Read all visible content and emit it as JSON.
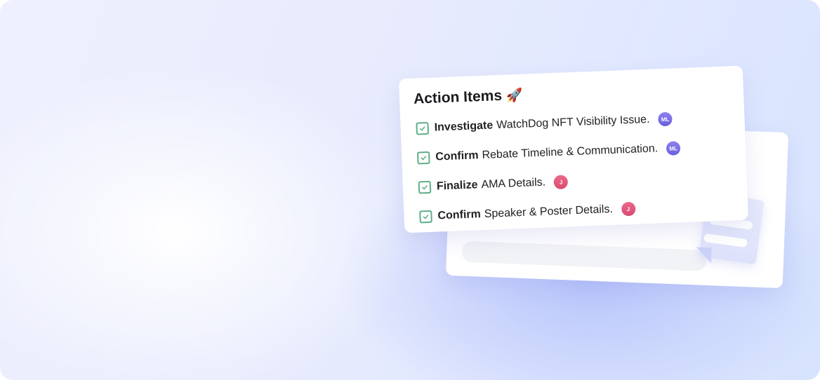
{
  "card": {
    "title": "Action Items",
    "title_emoji": "🚀"
  },
  "items": [
    {
      "verb": "Investigate",
      "text": "WatchDog NFT Visibility Issue.",
      "assignee": "ML",
      "done": true
    },
    {
      "verb": "Confirm",
      "text": "Rebate Timeline & Communication.",
      "assignee": "ML",
      "done": true
    },
    {
      "verb": "Finalize",
      "text": "AMA Details.",
      "assignee": "J",
      "done": true
    },
    {
      "verb": "Confirm",
      "text": "Speaker & Poster Details.",
      "assignee": "J",
      "done": true
    }
  ],
  "colors": {
    "check": "#5fae87",
    "avatar_ml": "#7a6fe8",
    "avatar_j": "#e25b7e",
    "background": "#e6ebfd"
  }
}
